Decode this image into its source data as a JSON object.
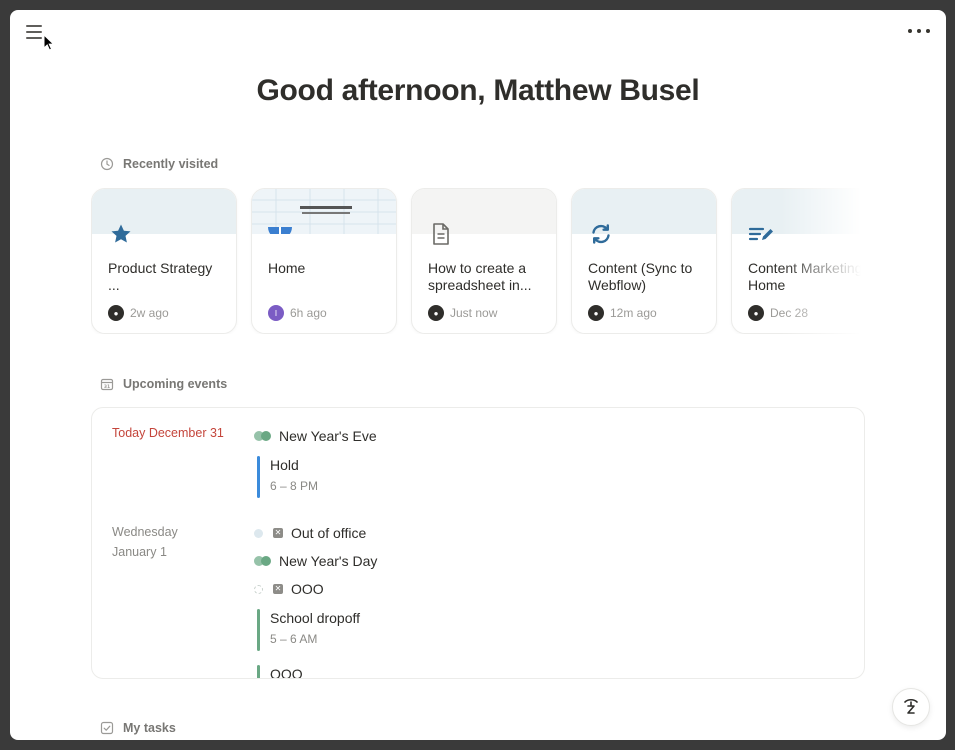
{
  "greeting": "Good afternoon, Matthew Busel",
  "sections": {
    "recent": "Recently visited",
    "events": "Upcoming events",
    "tasks": "My tasks"
  },
  "recent_cards": [
    {
      "title": "Product Strategy ...",
      "time": "2w ago",
      "icon": "star-icon",
      "top_color": "#e8f0f3",
      "avatar": "user-avatar"
    },
    {
      "title": "Home",
      "time": "6h ago",
      "icon": "cover-image",
      "top_color": "#eef4f8",
      "avatar": "I"
    },
    {
      "title": "How to create a spreadsheet in...",
      "time": "Just now",
      "icon": "document-icon",
      "top_color": "#f4f4f3",
      "avatar": "user-avatar"
    },
    {
      "title": "Content (Sync to Webflow)",
      "time": "12m ago",
      "icon": "sync-icon",
      "top_color": "#e8f0f3",
      "avatar": "user-avatar"
    },
    {
      "title": "Content Marketing Home",
      "time": "Dec 28",
      "icon": "edit-list-icon",
      "top_color": "#e8f0f3",
      "avatar": "user-avatar"
    }
  ],
  "events": {
    "today_label": "Today December 31",
    "next_label_line1": "Wednesday",
    "next_label_line2": "January 1",
    "today_items": [
      {
        "title": "New Year's Eve",
        "kind": "all-day"
      },
      {
        "title": "Hold",
        "time": "6 – 8 PM",
        "bar_color": "#3b8bdb"
      }
    ],
    "next_items": [
      {
        "title": "Out of office",
        "kind": "ooo"
      },
      {
        "title": "New Year's Day",
        "kind": "all-day"
      },
      {
        "title": "OOO",
        "kind": "ooo"
      },
      {
        "title": "School dropoff",
        "time": "5 – 6 AM",
        "bar_color": "#6aa884"
      },
      {
        "title": "OOO",
        "bar_color": "#6aa884"
      }
    ]
  },
  "colors": {
    "accent_blue": "#2f6b9a",
    "today_red": "#c4453b",
    "event_green": "#6aa884"
  }
}
